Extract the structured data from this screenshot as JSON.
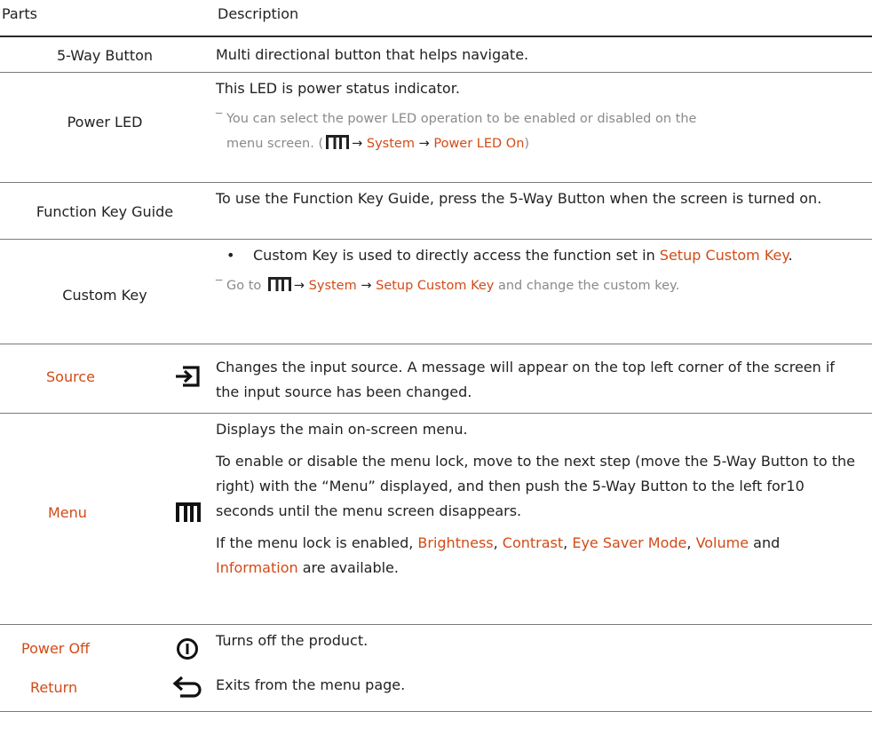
{
  "header": {
    "parts": "Parts",
    "description": "Description"
  },
  "rows": [
    {
      "part": "5-Way Button",
      "desc": "Multi directional button that helps navigate."
    },
    {
      "part": "Power LED",
      "desc": "This LED is power status indicator.",
      "note_a": "You can select the power LED operation to be enabled or disabled on the",
      "note_b": "menu screen. (",
      "arrow1": "→",
      "sys": "System",
      "arrow2": "→",
      "ledon": "Power LED On",
      "close": ")"
    },
    {
      "part": "Function Key Guide",
      "desc": "To use the Function Key Guide, press the 5-Way Button when the screen is turned on."
    },
    {
      "part": "Custom Key",
      "bullet": "•",
      "b1": "Custom Key is used to directly access the function set in ",
      "b1_hl": "Setup Custom Key",
      "b1_end": ".",
      "note_go": "Go to",
      "arrow1": "→",
      "sys": "System",
      "arrow2": "→",
      "setup": "Setup Custom Key",
      "note_end": "and change the custom key."
    },
    {
      "part": "Source",
      "icon": "source-input-icon",
      "desc": "Changes the input source. A message will appear on the top left corner of the screen if the input source has been changed."
    },
    {
      "part": "Menu",
      "icon": "menu-icon",
      "p1": "Displays the main on-screen menu.",
      "p2": "To enable or disable the menu lock, move to the next step (move the 5-Way Button to the right) with the “Menu” displayed, and then push the 5-Way Button to the left for10 seconds until the menu screen disappears.",
      "p3a": "If the menu lock is enabled, ",
      "brightness": "Brightness",
      "comma1": ", ",
      "contrast": "Contrast",
      "comma2": ", ",
      "eye": "Eye Saver Mode",
      "comma3": ", ",
      "volume": "Volume",
      "and": " and ",
      "information": "Information",
      "p3b": " are available."
    },
    {
      "part": "Power Off",
      "icon": "power-icon",
      "desc": "Turns off the product."
    },
    {
      "part": "Return",
      "icon": "return-arrow-icon",
      "desc": "Exits from the menu page."
    }
  ],
  "colors": {
    "accent": "#d24b17",
    "text": "#222222",
    "note": "#8a8a8a",
    "rule": "#7a7a7a"
  }
}
